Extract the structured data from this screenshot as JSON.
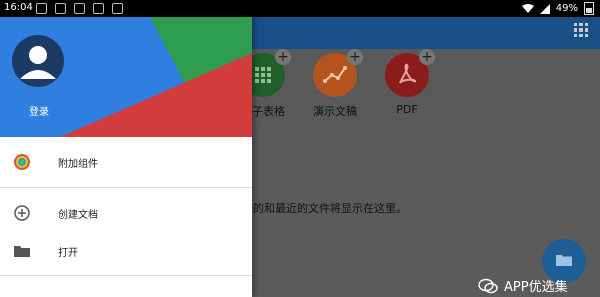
{
  "status_bar": {
    "time": "16:04",
    "battery": "49%"
  },
  "app": {
    "tiles": [
      {
        "label": "电子表格",
        "color": "#1f5f2a"
      },
      {
        "label": "演示文稿",
        "color": "#b4531e"
      },
      {
        "label": "PDF",
        "color": "#8a1c1c"
      }
    ],
    "empty_message": "的和最近的文件将显示在这里。"
  },
  "drawer": {
    "login": "登录",
    "items": [
      {
        "label": "附加组件",
        "icon": "addons-icon"
      },
      {
        "label": "创建文档",
        "icon": "add-circle-icon"
      },
      {
        "label": "打开",
        "icon": "folder-icon"
      }
    ],
    "header_colors": {
      "blue": "#2f7fe0",
      "green": "#2e9d4f",
      "red": "#d23c3c"
    }
  },
  "watermark": {
    "text": "APP优选集"
  }
}
